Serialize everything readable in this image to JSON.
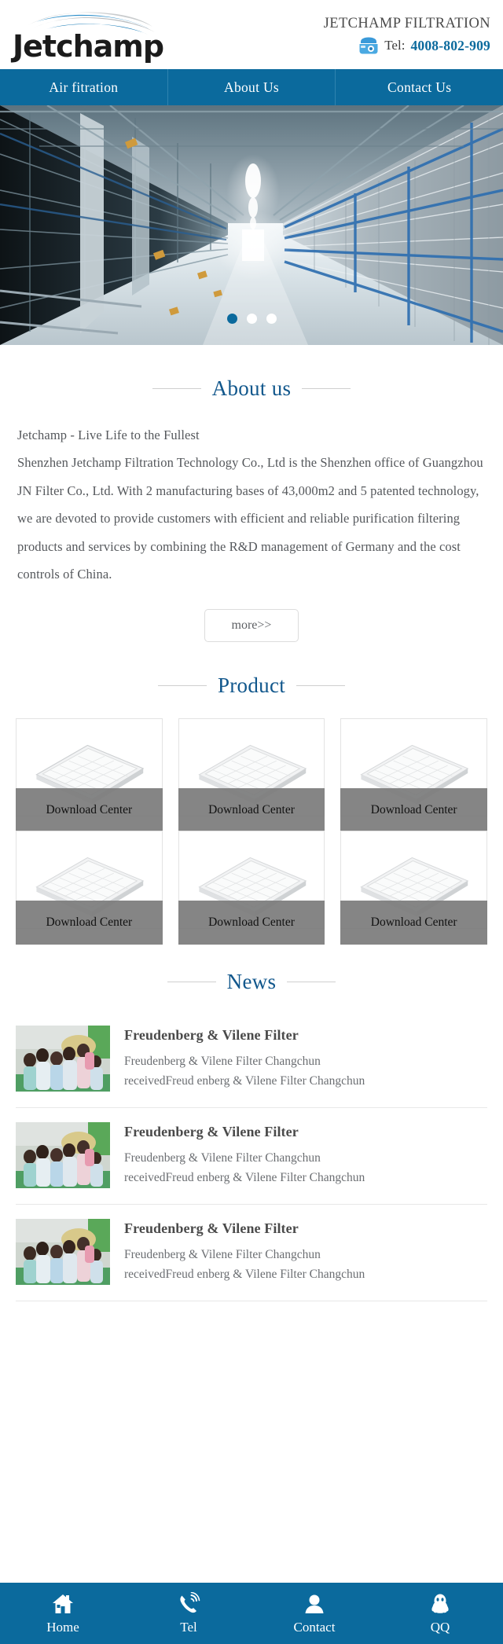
{
  "header": {
    "logo_text": "Jetchamp",
    "logo_icon": "wave-swoosh-logo",
    "brand_name": "JETCHAMP FILTRATION",
    "phone_icon": "telephone-icon",
    "tel_label": "Tel:",
    "tel_number": "4008-802-909"
  },
  "nav": {
    "items": [
      {
        "label": "Air fitration"
      },
      {
        "label": "About Us"
      },
      {
        "label": "Contact Us"
      }
    ]
  },
  "hero": {
    "image_alt": "air-filter-warehouse-corridor",
    "dots": [
      {
        "active": true
      },
      {
        "active": false
      },
      {
        "active": false
      }
    ]
  },
  "about": {
    "heading": "About us",
    "paragraphs": [
      "Jetchamp - Live Life to the Fullest",
      "Shenzhen Jetchamp Filtration Technology Co., Ltd is the Shenzhen office of Guangzhou JN Filter Co., Ltd. With 2 manufacturing bases of 43,000m2 and 5 patented technology, we are devoted to provide customers with efficient and reliable purification filtering products and services by combining the R&D management of Germany and the cost controls of China."
    ],
    "more_label": "more>>"
  },
  "product": {
    "heading": "Product",
    "items": [
      {
        "caption": "Download Center",
        "image_alt": "air-filter-panel"
      },
      {
        "caption": "Download Center",
        "image_alt": "air-filter-panel"
      },
      {
        "caption": "Download Center",
        "image_alt": "air-filter-panel"
      },
      {
        "caption": "Download Center",
        "image_alt": "air-filter-panel"
      },
      {
        "caption": "Download Center",
        "image_alt": "air-filter-panel"
      },
      {
        "caption": "Download Center",
        "image_alt": "air-filter-panel"
      }
    ]
  },
  "news": {
    "heading": "News",
    "items": [
      {
        "title": "Freudenberg & Vilene Filter",
        "desc_line1": "Freudenberg & Vilene Filter Changchun",
        "desc_line2": "receivedFreud enberg & Vilene Filter Changchun",
        "image_alt": "children-group-photo"
      },
      {
        "title": "Freudenberg & Vilene Filter",
        "desc_line1": "Freudenberg & Vilene Filter Changchun",
        "desc_line2": "receivedFreud enberg & Vilene Filter Changchun",
        "image_alt": "children-group-photo"
      },
      {
        "title": "Freudenberg & Vilene Filter",
        "desc_line1": "Freudenberg & Vilene Filter Changchun",
        "desc_line2": "receivedFreud enberg & Vilene Filter Changchun",
        "image_alt": "children-group-photo"
      }
    ]
  },
  "bottombar": {
    "items": [
      {
        "label": "Home",
        "icon": "home-icon"
      },
      {
        "label": "Tel",
        "icon": "phone-call-icon"
      },
      {
        "label": "Contact",
        "icon": "person-icon"
      },
      {
        "label": "QQ",
        "icon": "qq-penguin-icon"
      }
    ]
  },
  "colors": {
    "brand_blue": "#0b6a9d",
    "heading_blue": "#11578c",
    "caption_gray": "#7c7c7c"
  }
}
